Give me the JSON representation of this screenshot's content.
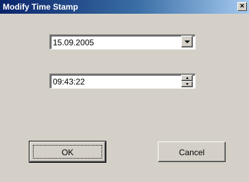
{
  "dialog": {
    "title": "Modify Time Stamp",
    "close_glyph": "×"
  },
  "date_picker": {
    "value": "15.09.2005",
    "icon": "chevron-down-icon"
  },
  "time_picker": {
    "value": "09:43:22",
    "icons": [
      "spin-up-icon",
      "spin-down-icon"
    ]
  },
  "buttons": {
    "ok_label": "OK",
    "cancel_label": "Cancel"
  },
  "colors": {
    "titlebar_start": "#0a246a",
    "titlebar_end": "#a6caf0",
    "face": "#d4d0c8"
  }
}
